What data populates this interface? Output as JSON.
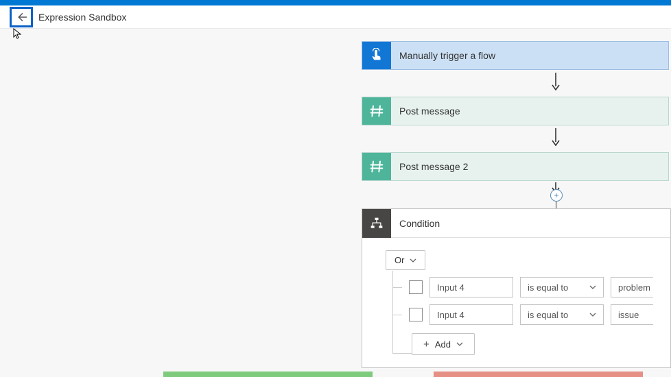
{
  "header": {
    "title": "Expression Sandbox"
  },
  "flow": {
    "trigger": {
      "label": "Manually trigger a flow"
    },
    "step1": {
      "label": "Post message"
    },
    "step2": {
      "label": "Post message 2"
    }
  },
  "condition": {
    "title": "Condition",
    "logic_label": "Or",
    "rows": [
      {
        "left": "Input 4",
        "op": "is equal to",
        "val": "problem"
      },
      {
        "left": "Input 4",
        "op": "is equal to",
        "val": "issue"
      }
    ],
    "add_label": "Add"
  }
}
